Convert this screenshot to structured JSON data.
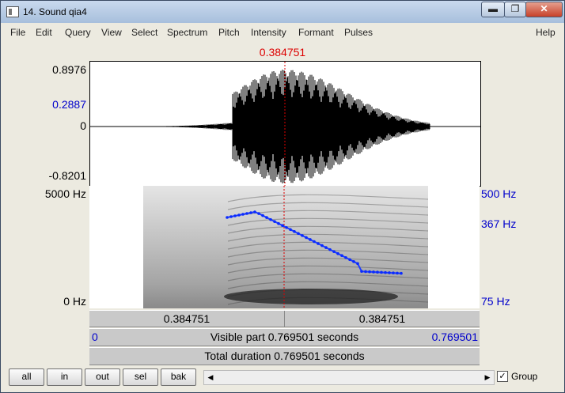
{
  "window": {
    "title": "14. Sound qia4",
    "minimize": "▬",
    "maximize": "❐",
    "close": "✕"
  },
  "menu": [
    "File",
    "Edit",
    "Query",
    "View",
    "Select",
    "Spectrum",
    "Pitch",
    "Intensity",
    "Formant",
    "Pulses",
    "Help"
  ],
  "cursor_time": "0.384751",
  "waveform": {
    "ymax": "0.8976",
    "ycursor": "0.2887",
    "yzero": "0",
    "ymin": "-0.8201"
  },
  "spectrogram": {
    "freq_top": "5000 Hz",
    "freq_bottom": "0 Hz",
    "pitch_top": "500 Hz",
    "pitch_mid": "367 Hz",
    "pitch_bottom": "75 Hz"
  },
  "time_bar": {
    "left": "0.384751",
    "right": "0.384751"
  },
  "visible_bar": {
    "start": "0",
    "text": "Visible part 0.769501 seconds",
    "end": "0.769501"
  },
  "total_bar": {
    "text": "Total duration 0.769501 seconds"
  },
  "buttons": {
    "all": "all",
    "in": "in",
    "out": "out",
    "sel": "sel",
    "bak": "bak"
  },
  "scroll": {
    "left_arrow": "◀",
    "right_arrow": "▶"
  },
  "group": {
    "label": "Group",
    "checked": "✓"
  },
  "colors": {
    "cursor": "#dd0000",
    "pitch": "#1e3cff",
    "axis_blue": "#0000cc"
  }
}
